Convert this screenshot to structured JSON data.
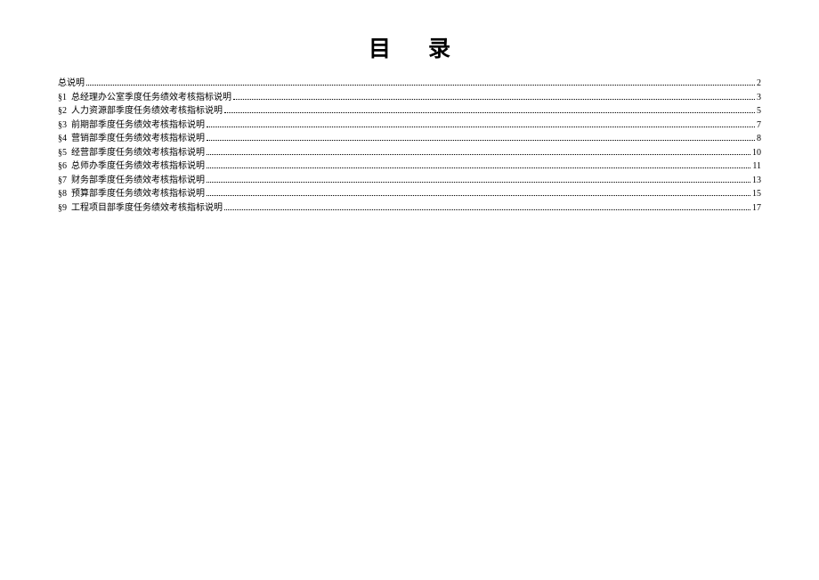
{
  "title": "目录",
  "toc": {
    "entries": [
      {
        "prefix": "",
        "label": "总说明",
        "page": "2"
      },
      {
        "prefix": "§1",
        "label": "总经理办公室季度任务绩效考核指标说明",
        "page": "3"
      },
      {
        "prefix": "§2",
        "label": "人力资源部季度任务绩效考核指标说明",
        "page": "5"
      },
      {
        "prefix": "§3",
        "label": "前期部季度任务绩效考核指标说明",
        "page": "7"
      },
      {
        "prefix": "§4",
        "label": "营销部季度任务绩效考核指标说明",
        "page": "8"
      },
      {
        "prefix": "§5",
        "label": "经营部季度任务绩效考核指标说明",
        "page": "10"
      },
      {
        "prefix": "§6",
        "label": "总师办季度任务绩效考核指标说明",
        "page": "11"
      },
      {
        "prefix": "§7",
        "label": "财务部季度任务绩效考核指标说明",
        "page": "13"
      },
      {
        "prefix": "§8",
        "label": "预算部季度任务绩效考核指标说明",
        "page": "15"
      },
      {
        "prefix": "§9",
        "label": "工程项目部季度任务绩效考核指标说明",
        "page": "17"
      }
    ]
  }
}
